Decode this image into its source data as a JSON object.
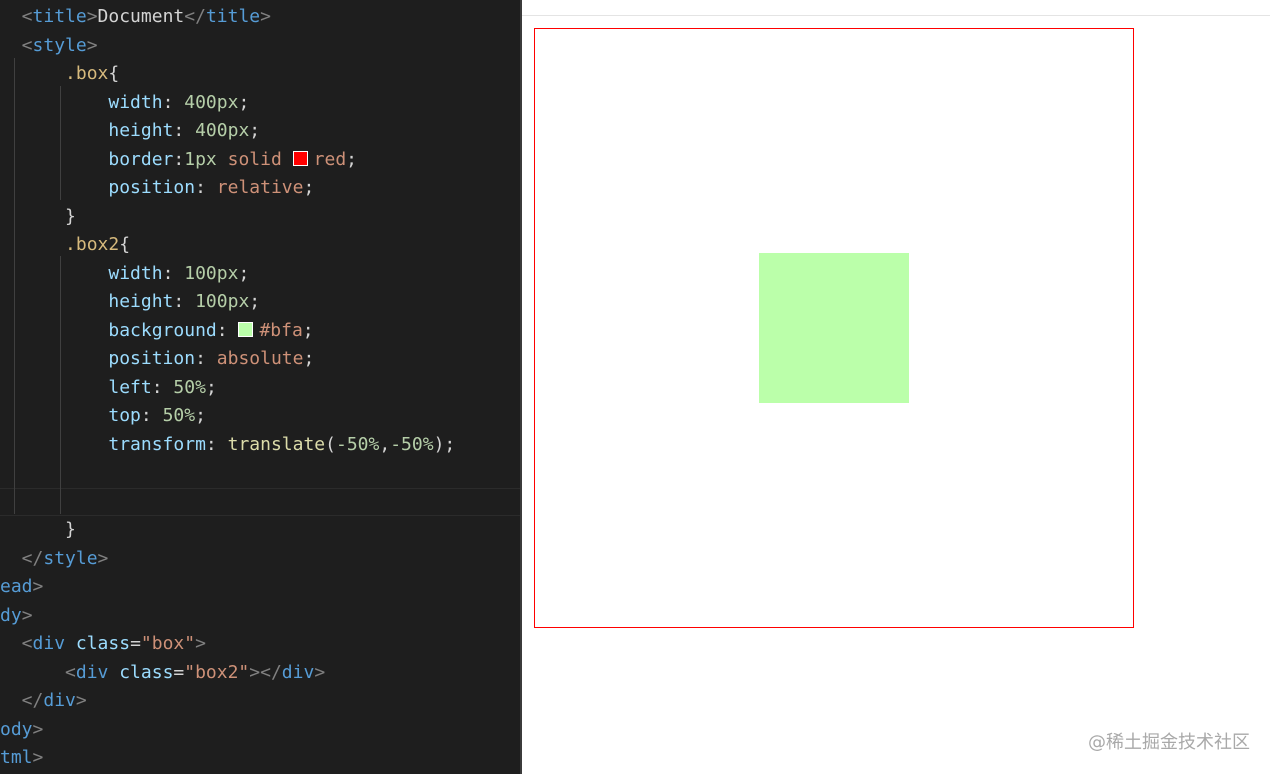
{
  "editor": {
    "lines": [
      [
        {
          "t": "  <",
          "c": "punc"
        },
        {
          "t": "title",
          "c": "tag"
        },
        {
          "t": ">",
          "c": "punc"
        },
        {
          "t": "Document",
          "c": "text"
        },
        {
          "t": "</",
          "c": "punc"
        },
        {
          "t": "title",
          "c": "tag"
        },
        {
          "t": ">",
          "c": "punc"
        }
      ],
      [
        {
          "t": "  <",
          "c": "punc"
        },
        {
          "t": "style",
          "c": "tag"
        },
        {
          "t": ">",
          "c": "punc"
        }
      ],
      [
        {
          "t": "      ",
          "c": "text"
        },
        {
          "t": ".box",
          "c": "sel"
        },
        {
          "t": "{",
          "c": "text"
        }
      ],
      [
        {
          "t": "          ",
          "c": "text"
        },
        {
          "t": "width",
          "c": "prop"
        },
        {
          "t": ": ",
          "c": "text"
        },
        {
          "t": "400px",
          "c": "num"
        },
        {
          "t": ";",
          "c": "text"
        }
      ],
      [
        {
          "t": "          ",
          "c": "text"
        },
        {
          "t": "height",
          "c": "prop"
        },
        {
          "t": ": ",
          "c": "text"
        },
        {
          "t": "400px",
          "c": "num"
        },
        {
          "t": ";",
          "c": "text"
        }
      ],
      [
        {
          "t": "          ",
          "c": "text"
        },
        {
          "t": "border",
          "c": "prop"
        },
        {
          "t": ":",
          "c": "text"
        },
        {
          "t": "1px",
          "c": "num"
        },
        {
          "t": " ",
          "c": "text"
        },
        {
          "t": "solid",
          "c": "val"
        },
        {
          "t": " ",
          "c": "text"
        },
        {
          "swatch": "#ff0000"
        },
        {
          "t": "red",
          "c": "val"
        },
        {
          "t": ";",
          "c": "text"
        }
      ],
      [
        {
          "t": "          ",
          "c": "text"
        },
        {
          "t": "position",
          "c": "prop"
        },
        {
          "t": ": ",
          "c": "text"
        },
        {
          "t": "relative",
          "c": "val"
        },
        {
          "t": ";",
          "c": "text"
        }
      ],
      [
        {
          "t": "      ",
          "c": "text"
        },
        {
          "t": "}",
          "c": "text"
        }
      ],
      [
        {
          "t": "      ",
          "c": "text"
        },
        {
          "t": ".box2",
          "c": "sel"
        },
        {
          "t": "{",
          "c": "text"
        }
      ],
      [
        {
          "t": "          ",
          "c": "text"
        },
        {
          "t": "width",
          "c": "prop"
        },
        {
          "t": ": ",
          "c": "text"
        },
        {
          "t": "100px",
          "c": "num"
        },
        {
          "t": ";",
          "c": "text"
        }
      ],
      [
        {
          "t": "          ",
          "c": "text"
        },
        {
          "t": "height",
          "c": "prop"
        },
        {
          "t": ": ",
          "c": "text"
        },
        {
          "t": "100px",
          "c": "num"
        },
        {
          "t": ";",
          "c": "text"
        }
      ],
      [
        {
          "t": "          ",
          "c": "text"
        },
        {
          "t": "background",
          "c": "prop"
        },
        {
          "t": ": ",
          "c": "text"
        },
        {
          "swatch": "#bbffaa"
        },
        {
          "t": "#bfa",
          "c": "val"
        },
        {
          "t": ";",
          "c": "text"
        }
      ],
      [
        {
          "t": "          ",
          "c": "text"
        },
        {
          "t": "position",
          "c": "prop"
        },
        {
          "t": ": ",
          "c": "text"
        },
        {
          "t": "absolute",
          "c": "val"
        },
        {
          "t": ";",
          "c": "text"
        }
      ],
      [
        {
          "t": "          ",
          "c": "text"
        },
        {
          "t": "left",
          "c": "prop"
        },
        {
          "t": ": ",
          "c": "text"
        },
        {
          "t": "50%",
          "c": "num"
        },
        {
          "t": ";",
          "c": "text"
        }
      ],
      [
        {
          "t": "          ",
          "c": "text"
        },
        {
          "t": "top",
          "c": "prop"
        },
        {
          "t": ": ",
          "c": "text"
        },
        {
          "t": "50%",
          "c": "num"
        },
        {
          "t": ";",
          "c": "text"
        }
      ],
      [
        {
          "t": "          ",
          "c": "text"
        },
        {
          "t": "transform",
          "c": "prop"
        },
        {
          "t": ": ",
          "c": "text"
        },
        {
          "t": "translate",
          "c": "fn"
        },
        {
          "t": "(",
          "c": "text"
        },
        {
          "t": "-50%",
          "c": "num"
        },
        {
          "t": ",",
          "c": "text"
        },
        {
          "t": "-50%",
          "c": "num"
        },
        {
          "t": ");",
          "c": "text"
        }
      ],
      [],
      [],
      [
        {
          "t": "      ",
          "c": "text"
        },
        {
          "t": "}",
          "c": "text"
        }
      ],
      [
        {
          "t": "  </",
          "c": "punc"
        },
        {
          "t": "style",
          "c": "tag"
        },
        {
          "t": ">",
          "c": "punc"
        }
      ],
      [
        {
          "t": "ead",
          "c": "tag"
        },
        {
          "t": ">",
          "c": "punc"
        }
      ],
      [
        {
          "t": "dy",
          "c": "tag"
        },
        {
          "t": ">",
          "c": "punc"
        }
      ],
      [
        {
          "t": "  <",
          "c": "punc"
        },
        {
          "t": "div",
          "c": "tag"
        },
        {
          "t": " ",
          "c": "text"
        },
        {
          "t": "class",
          "c": "attr"
        },
        {
          "t": "=",
          "c": "text"
        },
        {
          "t": "\"box\"",
          "c": "str"
        },
        {
          "t": ">",
          "c": "punc"
        }
      ],
      [
        {
          "t": "      <",
          "c": "punc"
        },
        {
          "t": "div",
          "c": "tag"
        },
        {
          "t": " ",
          "c": "text"
        },
        {
          "t": "class",
          "c": "attr"
        },
        {
          "t": "=",
          "c": "text"
        },
        {
          "t": "\"box2\"",
          "c": "str"
        },
        {
          "t": "></",
          "c": "punc"
        },
        {
          "t": "div",
          "c": "tag"
        },
        {
          "t": ">",
          "c": "punc"
        }
      ],
      [
        {
          "t": "  </",
          "c": "punc"
        },
        {
          "t": "div",
          "c": "tag"
        },
        {
          "t": ">",
          "c": "punc"
        }
      ],
      [
        {
          "t": "ody",
          "c": "tag"
        },
        {
          "t": ">",
          "c": "punc"
        }
      ],
      [
        {
          "t": "tml",
          "c": "tag"
        },
        {
          "t": ">",
          "c": "punc"
        }
      ]
    ],
    "current_line": 17
  },
  "preview": {
    "box_border_color": "#ff0000",
    "box2_background": "#bbffaa"
  },
  "watermark": "@稀土掘金技术社区"
}
